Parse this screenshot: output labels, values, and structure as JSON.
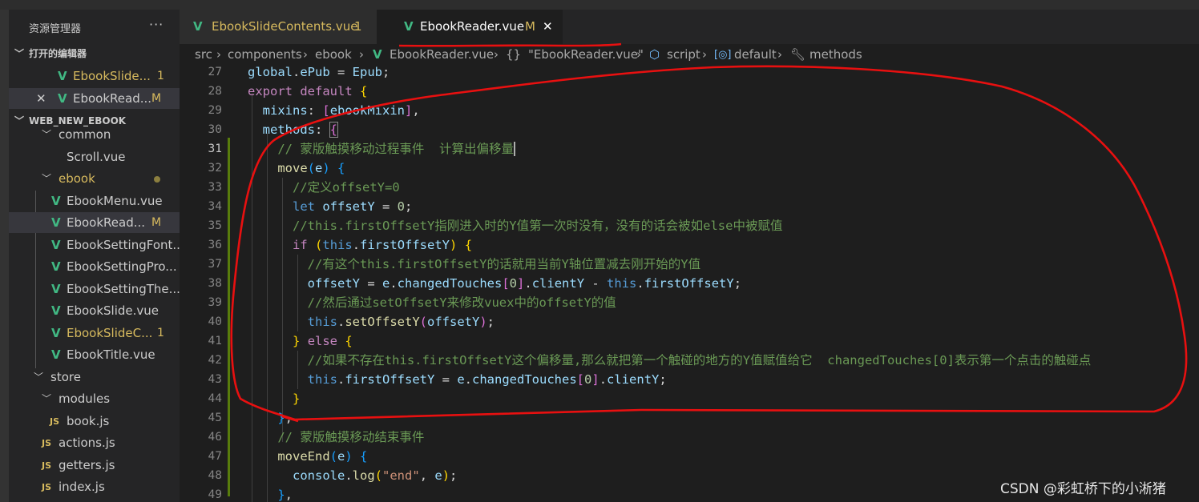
{
  "explorer": {
    "title": "资源管理器",
    "more": "···",
    "open_editors_label": "打开的编辑器",
    "open_editors": [
      {
        "name": "EbookSlide...",
        "badge": "1"
      },
      {
        "name": "EbookRead...",
        "badge": "M"
      }
    ],
    "project_label": "WEB_NEW_EBOOK",
    "tree": {
      "common": "common",
      "scroll": "Scroll.vue",
      "ebook": "ebook",
      "ebook_files": [
        {
          "name": "EbookMenu.vue",
          "badge": ""
        },
        {
          "name": "EbookRead...",
          "badge": "M"
        },
        {
          "name": "EbookSettingFont...",
          "badge": ""
        },
        {
          "name": "EbookSettingPro...",
          "badge": ""
        },
        {
          "name": "EbookSettingThe...",
          "badge": ""
        },
        {
          "name": "EbookSlide.vue",
          "badge": ""
        },
        {
          "name": "EbookSlideC...",
          "badge": "1"
        },
        {
          "name": "EbookTitle.vue",
          "badge": ""
        }
      ],
      "store": "store",
      "modules": "modules",
      "book_js": "book.js",
      "actions_js": "actions.js",
      "getters_js": "getters.js",
      "index_js": "index.js",
      "js_icon": "JS",
      "vue_icon": "V"
    }
  },
  "tabs": [
    {
      "name": "EbookSlideContents.vue",
      "badge": "1",
      "color": "#d7ba5e"
    },
    {
      "name": "EbookReader.vue",
      "badge": "M",
      "close": "✕",
      "color": "#d7ba5e"
    }
  ],
  "breadcrumb": {
    "src": "src",
    "components": "components",
    "ebook": "ebook",
    "file": "EbookReader.vue",
    "obj": "\"EbookReader.vue\"",
    "script": "script",
    "default": "default",
    "methods": "methods"
  },
  "editor": {
    "active_line": 31,
    "line_numbers": [
      "27",
      "28",
      "29",
      "30",
      "31",
      "32",
      "33",
      "34",
      "35",
      "36",
      "37",
      "38",
      "39",
      "40",
      "41",
      "42",
      "43",
      "44",
      "45",
      "46",
      "47",
      "48",
      "49"
    ],
    "comments": {
      "c31": "// 蒙版触摸移动过程事件  计算出偏移量",
      "c33": "//定义offsetY=0",
      "c35": "//this.firstOffsetY指刚进入时的Y值第一次时没有，没有的话会被如else中被赋值",
      "c37": "//有这个this.firstOffsetY的话就用当前Y轴位置减去刚开始的Y值",
      "c39": "//然后通过setOffsetY来修改vuex中的offsetY的值",
      "c42": "//如果不存在this.firstOffsetY这个偏移量,那么就把第一个触碰的地方的Y值赋值给它  changedTouches[0]表示第一个点击的触碰点",
      "c46": "// 蒙版触摸移动结束事件"
    },
    "strings": {
      "end": "\"end\""
    }
  },
  "watermark": "CSDN @彩虹桥下的小淅猪",
  "colors": {
    "annotation": "#e81010",
    "vue": "#41b883",
    "modified": "#d7ba5e"
  }
}
